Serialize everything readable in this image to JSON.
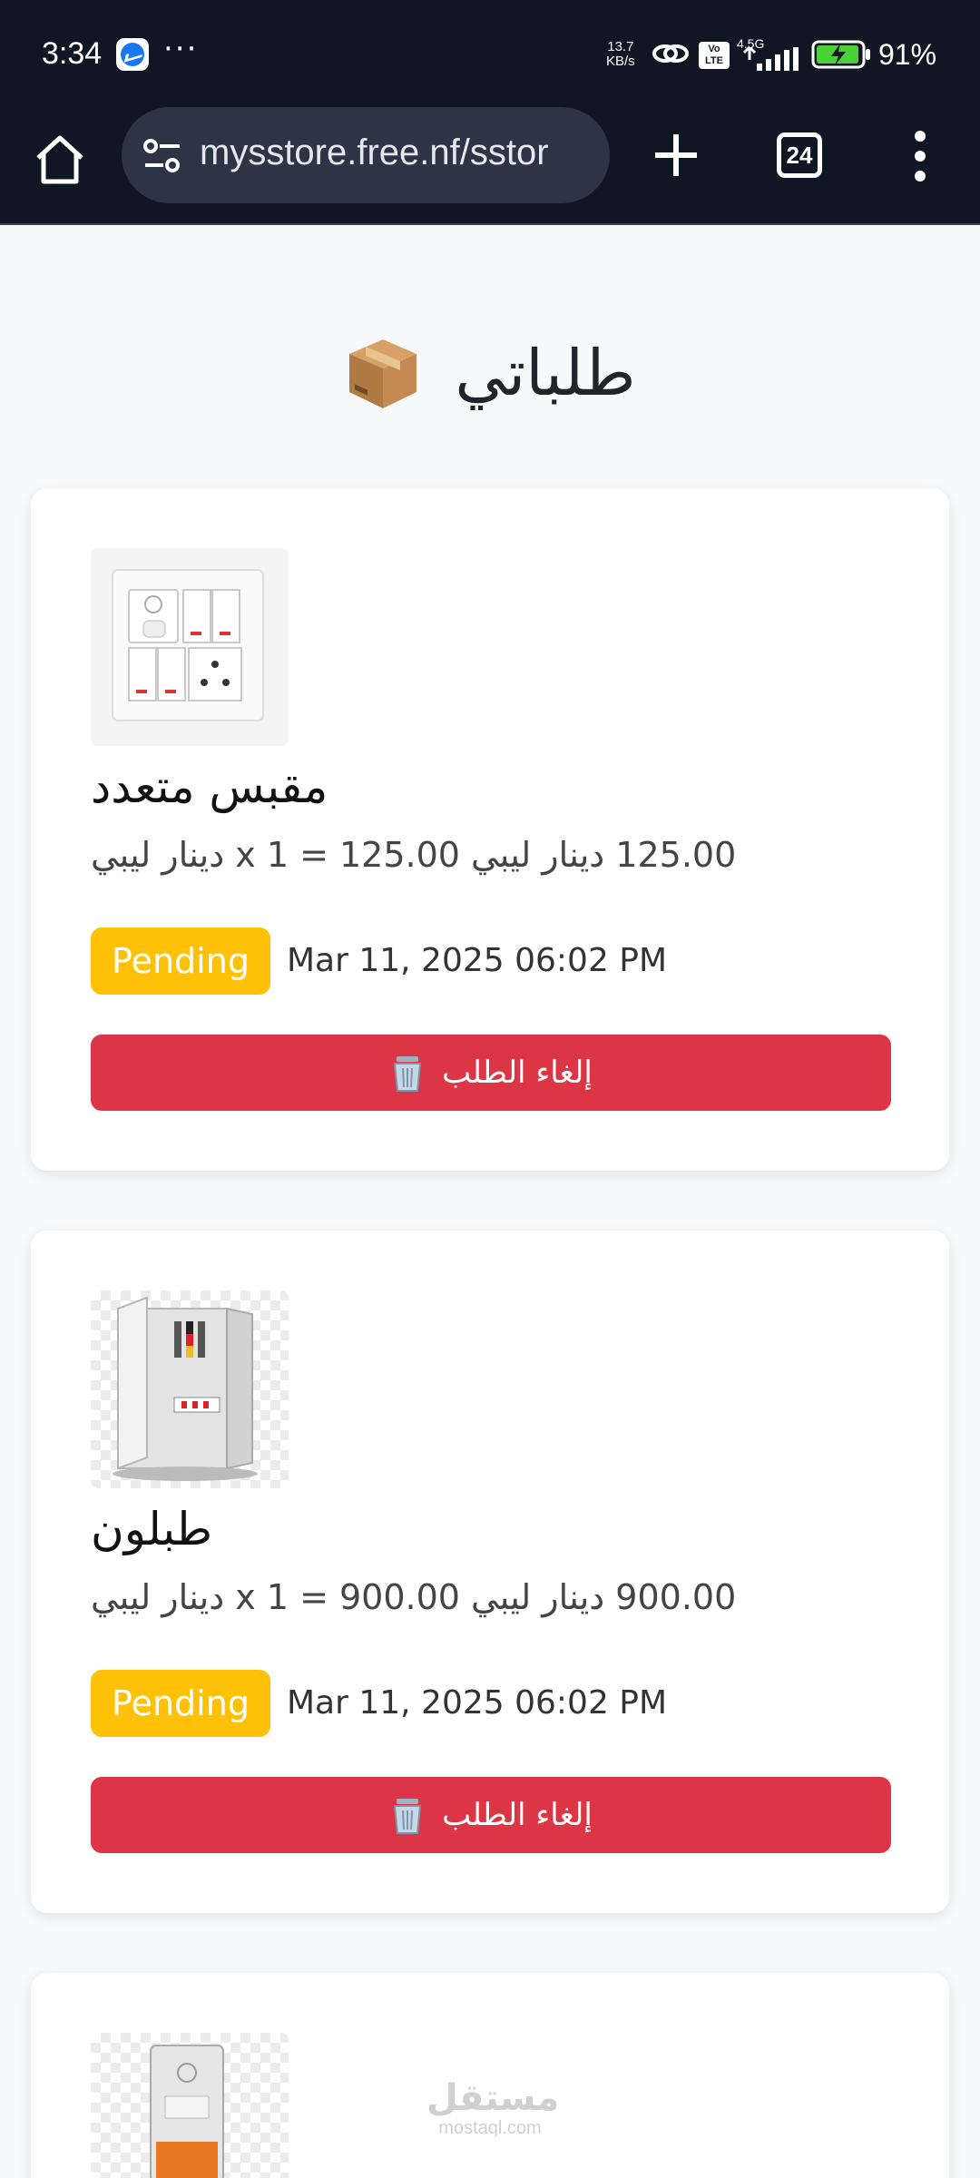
{
  "status_bar": {
    "time": "3:34",
    "more": "···",
    "net_speed_value": "13.7",
    "net_speed_unit": "KB/s",
    "volte": "Vo LTE",
    "network": "4.5G",
    "battery_percent": "91%"
  },
  "browser": {
    "url": "mysstore.free.nf/sstor",
    "tab_count": "24"
  },
  "page": {
    "title": "طلباتي",
    "orders": [
      {
        "name": "مقبس متعدد",
        "price_line": "125.00 دينار ليبي x 1 = 125.00 دينار ليبي",
        "status": "Pending",
        "date": "Mar 11, 2025 06:02 PM",
        "cancel_label": "إلغاء الطلب"
      },
      {
        "name": "طبلون",
        "price_line": "900.00 دينار ليبي x 1 = 900.00 دينار ليبي",
        "status": "Pending",
        "date": "Mar 11, 2025 06:02 PM",
        "cancel_label": "إلغاء الطلب"
      }
    ]
  },
  "watermark": {
    "arabic": "مستقل",
    "latin": "mostaql.com"
  },
  "colors": {
    "status_bar_bg": "#111625",
    "url_box_bg": "#2d3446",
    "pending_badge": "#ffc107",
    "cancel_button": "#dc3545"
  }
}
